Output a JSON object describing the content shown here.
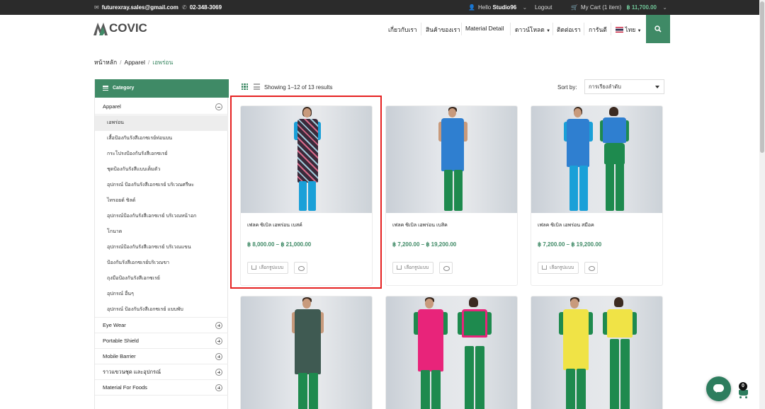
{
  "topbar": {
    "email": "futurexray.sales@gmail.com",
    "phone": "02-348-3069",
    "hello": "Hello",
    "user": "Studio96",
    "logout": "Logout",
    "cart_label": "My Cart (1 item)",
    "cart_total": "฿ 11,700.00"
  },
  "header": {
    "logo_text": "COVIC",
    "nav": [
      "เกี่ยวกับเรา",
      "สินค้าของเรา",
      "Material Detail",
      "ดาวน์โหลด",
      "ติดต่อเรา",
      "การันตี",
      "ไทย"
    ],
    "brand_color": "#3f8a66"
  },
  "breadcrumb": {
    "home": "หน้าหลัก",
    "level1": "Apparel",
    "current": "เอพร่อน"
  },
  "sidebar": {
    "title": "Category",
    "open_category": "Apparel",
    "sub_items": [
      "เอพร่อน",
      "เสื้อป้องกันรังสีเอกซเรย์ท่อนบน",
      "กระโปรงป้องกันรังสีเอกซเรย์",
      "ชุดป้องกันรังสีแบบเต็มตัว",
      "อุปกรณ์ ป้องกันรังสีเอกซเรย์ บริเวณศรีษะ",
      "ไทรอยด์ ชิลด์",
      "อุปกรณ์ป้องกันรังสีเอกซเรย์ บริเวณหน้าอก",
      "โกนาด",
      "อุปกรณ์ป้องกันรังสีเอกซเรย์ บริเวณแขน",
      "ป้องกันรังสีเอกซเรย์บริเวณขา",
      "ถุงมือป้องกันรังสีเอกซเรย์",
      "อุปกรณ์ อื่นๆ",
      "อุปกรณ์ ป้องกันรังสีเอกซเรย์ แบบพับ"
    ],
    "other_categories": [
      "Eye Wear",
      "Portable Shield",
      "Mobile Barrier",
      "ราวแขวนชุด และอุปกรณ์",
      "Material For Foods"
    ]
  },
  "toolbar": {
    "showing": "Showing 1–12 of 13 results",
    "sort_label": "Sort by:",
    "sort_value": "การเรียงลำดับ"
  },
  "products": [
    {
      "name": "เฟลค ซิเบิล เอพร่อน เบสค์",
      "price": "฿ 8,000.00 – ฿ 21,000.00",
      "button": "เลือกรูปแบบ",
      "apron_color": "#3a2a3a"
    },
    {
      "name": "เฟลค ซิเบิล เอพร่อน เบสิค",
      "price": "฿ 7,200.00 – ฿ 19,200.00",
      "button": "เลือกรูปแบบ",
      "apron_color": "#2f7fd0"
    },
    {
      "name": "เฟลค ซิเบิล เอพร่อน สมีอค",
      "price": "฿ 7,200.00 – ฿ 19,200.00",
      "button": "เลือกรูปแบบ",
      "apron_color": "#2f7fd0"
    },
    {
      "name": "",
      "price": "",
      "button": "",
      "apron_color": "#3f5a52"
    },
    {
      "name": "",
      "price": "",
      "button": "",
      "apron_color": "#e8247a"
    },
    {
      "name": "",
      "price": "",
      "button": "",
      "apron_color": "#f0e346"
    }
  ],
  "cart_badge": "0"
}
